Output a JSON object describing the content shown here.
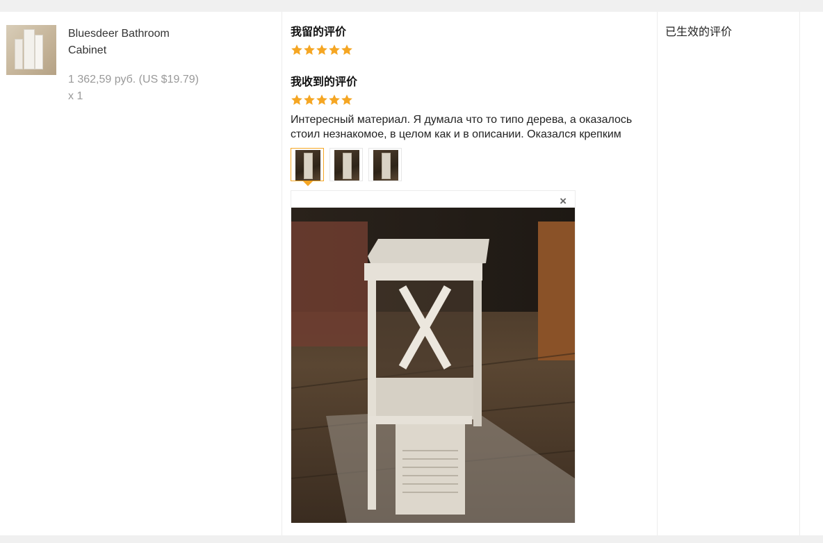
{
  "product": {
    "title_line1": "Bluesdeer Bathroom",
    "title_line2": "Cabinet",
    "price": "1 362,59 руб. (US $19.79)",
    "quantity": "x 1",
    "thumbnail_icon": "bathroom-cabinet-thumbnail"
  },
  "review": {
    "my_review_title": "我留的评价",
    "my_review_rating": 5,
    "received_review_title": "我收到的评价",
    "received_review_rating": 5,
    "received_review_text_line1": "Интересный материал. Я думала что то типо дерева, а оказалось",
    "received_review_text_line2": "стоил незнакомое, в целом как и в описании. Оказался крепким",
    "photo_count": 3,
    "selected_photo_index": 0,
    "close_label": "×",
    "star_color": "#f5a623"
  },
  "status": {
    "label": "已生效的评价"
  }
}
